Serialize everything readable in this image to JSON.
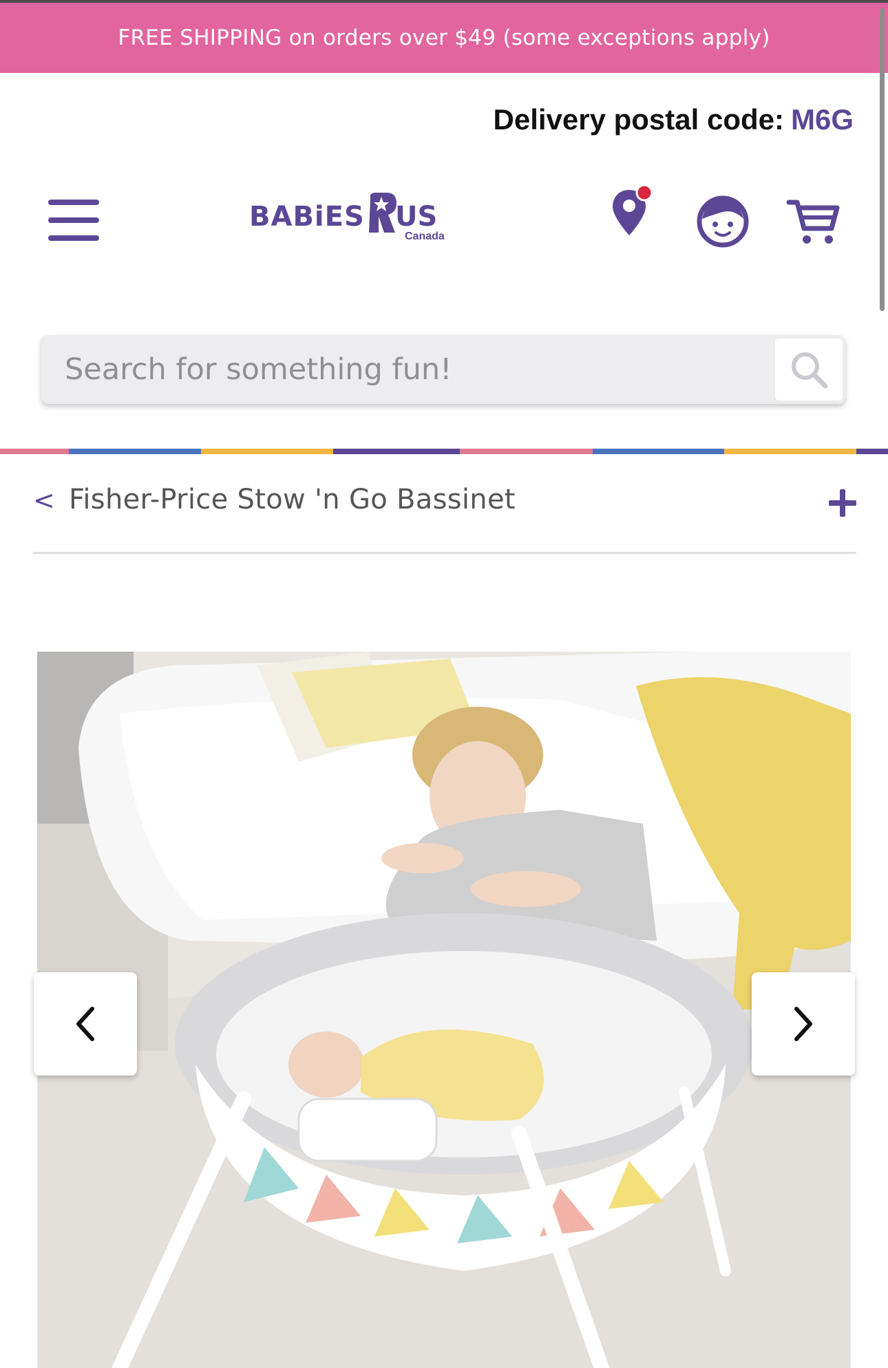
{
  "promo": {
    "text": "FREE SHIPPING on orders over $49 (some exceptions apply)"
  },
  "delivery": {
    "label": "Delivery postal code:",
    "code": "M6G"
  },
  "header": {
    "logo": {
      "brand": "BABiES R US",
      "region": "Canada"
    },
    "icons": [
      "menu-icon",
      "location-pin-icon",
      "account-icon",
      "cart-icon"
    ]
  },
  "search": {
    "placeholder": "Search for something fun!"
  },
  "stripe_colors": [
    "#e07a92",
    "#4a74bd",
    "#f1b643",
    "#5b4795",
    "#e07a92",
    "#4a74bd",
    "#f1b643",
    "#5b4795"
  ],
  "breadcrumb": {
    "back": "<",
    "title": "Fisher-Price Stow 'n Go Bassinet"
  },
  "gallery": {
    "prev": "previous-image",
    "next": "next-image"
  },
  "colors": {
    "brand_purple": "#5b4795",
    "promo_pink": "#e2659d",
    "notification_red": "#d7263d"
  }
}
